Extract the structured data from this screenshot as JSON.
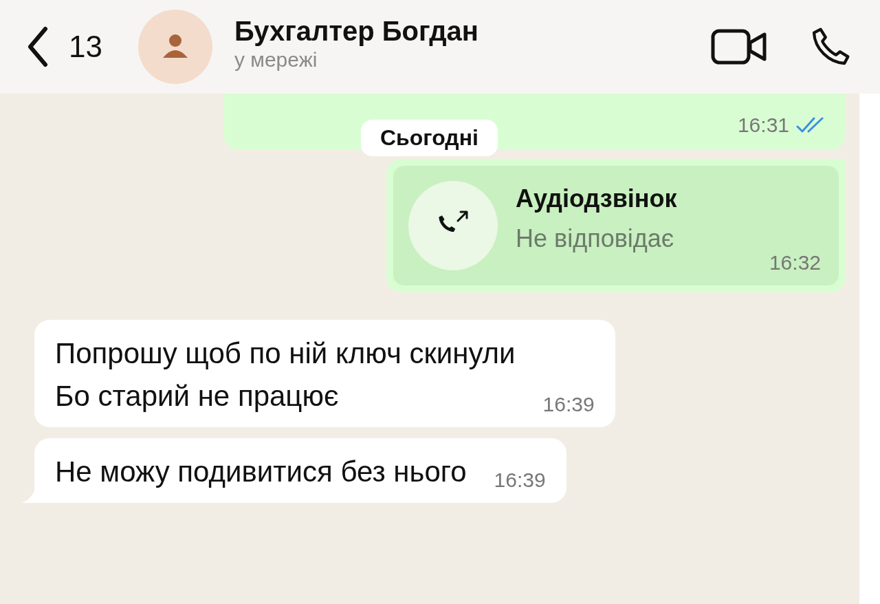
{
  "header": {
    "back_count": "13",
    "name": "Бухгалтер Богдан",
    "status": "у мережі"
  },
  "messages": [
    {
      "kind": "outgoing",
      "time": "16:31",
      "read": true
    },
    {
      "kind": "date",
      "label": "Сьогодні"
    },
    {
      "kind": "call",
      "title": "Аудіодзвінок",
      "subtitle": "Не відповідає",
      "time": "16:32"
    },
    {
      "kind": "incoming",
      "lines": [
        "Попрошу щоб по ній ключ скинули",
        "Бо старий не працює"
      ],
      "time": "16:39",
      "tail": false
    },
    {
      "kind": "incoming",
      "lines": [
        "Не можу подивитися без нього"
      ],
      "time": "16:39",
      "tail": true
    }
  ]
}
